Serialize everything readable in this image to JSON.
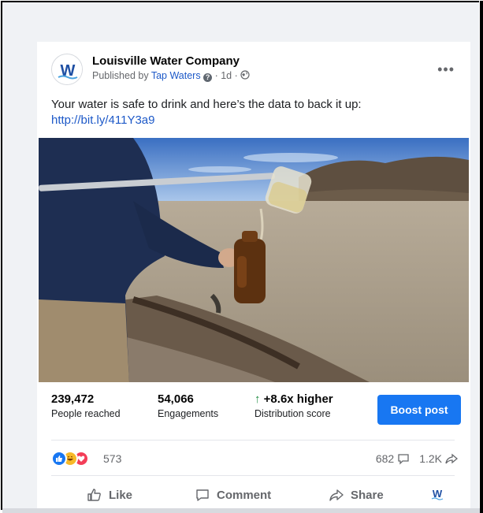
{
  "post": {
    "page_name": "Louisville Water Company",
    "published_prefix": "Published by",
    "publisher": "Tap Waters",
    "age": "1d",
    "separator": "·",
    "caption": "Your water is safe to drink and here’s the data to back it up:",
    "link": "http://bit.ly/411Y3a9",
    "more_label": "•••",
    "logo_letter": "W"
  },
  "stats": {
    "reached_value": "239,472",
    "reached_label": "People reached",
    "engagements_value": "54,066",
    "engagements_label": "Engagements",
    "distribution_value": "+8.6x higher",
    "distribution_label": "Distribution score",
    "boost_label": "Boost post"
  },
  "reactions": {
    "count": "573",
    "comments": "682",
    "shares": "1.2K"
  },
  "actions": {
    "like": "Like",
    "comment": "Comment",
    "share": "Share"
  },
  "colors": {
    "accent": "#1877f2",
    "link": "#1d59c8",
    "positive": "#1b8a3e"
  }
}
